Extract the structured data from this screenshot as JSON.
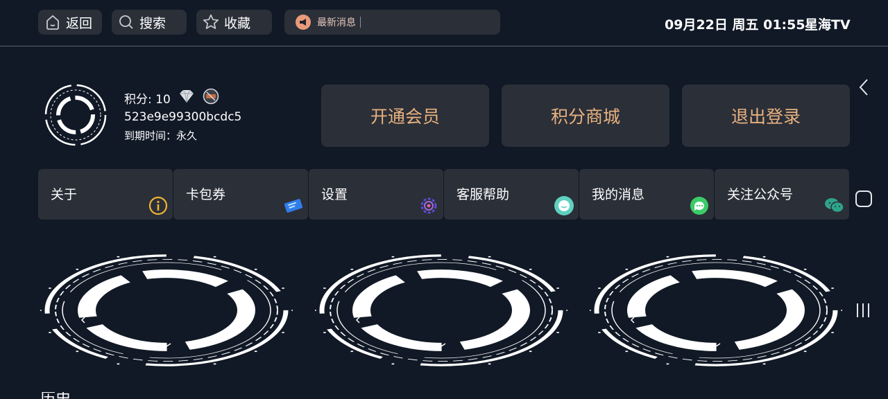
{
  "topbar": {
    "back_label": "返回",
    "search_label": "搜索",
    "favorite_label": "收藏",
    "news_label": "最新消息",
    "datetime": "09月22日 周五 01:55",
    "brand": "星海TV"
  },
  "user": {
    "points_text": "积分: 10",
    "user_id": "523e9e99300bcdc5",
    "expiry_text": "到期时间：永久"
  },
  "actions": [
    {
      "label": "开通会员"
    },
    {
      "label": "积分商城"
    },
    {
      "label": "退出登录"
    }
  ],
  "tiles": [
    {
      "label": "关于",
      "icon": "info-icon",
      "color": "#f1b533"
    },
    {
      "label": "卡包券",
      "icon": "coupon-icon",
      "color": "#2f7de8"
    },
    {
      "label": "设置",
      "icon": "settings-icon",
      "color": "#6f5bd9"
    },
    {
      "label": "客服帮助",
      "icon": "customer-service-icon",
      "color": "#5ed1c0"
    },
    {
      "label": "我的消息",
      "icon": "message-icon",
      "color": "#3ccb67"
    },
    {
      "label": "关注公众号",
      "icon": "wechat-icon",
      "color": "#2ea38a"
    }
  ],
  "section_title_partial": "历史",
  "colors": {
    "background": "#111926",
    "panel": "#2b2f38",
    "accent_text": "#e9b27f",
    "divider": "#5a6170"
  }
}
